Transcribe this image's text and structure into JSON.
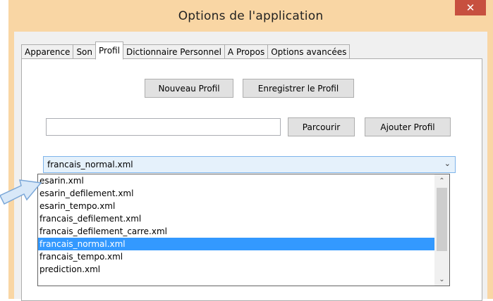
{
  "window": {
    "title": "Options de l'application",
    "close_glyph": "✕"
  },
  "tabs": [
    {
      "label": "Apparence"
    },
    {
      "label": "Son"
    },
    {
      "label": "Profil",
      "active": true
    },
    {
      "label": "Dictionnaire Personnel"
    },
    {
      "label": "A Propos"
    },
    {
      "label": "Options avancées"
    }
  ],
  "buttons": {
    "new_profile": "Nouveau Profil",
    "save_profile": "Enregistrer le Profil",
    "browse": "Parcourir",
    "add_profile": "Ajouter Profil"
  },
  "path_input": {
    "value": ""
  },
  "profile_select": {
    "selected": "francais_normal.xml",
    "options": [
      "esarin.xml",
      "esarin_defilement.xml",
      "esarin_tempo.xml",
      "francais_defilement.xml",
      "francais_defilement_carre.xml",
      "francais_normal.xml",
      "francais_tempo.xml",
      "prediction.xml"
    ]
  },
  "icons": {
    "dropdown": "chevron-down-icon",
    "scroll_up": "chevron-up-icon",
    "scroll_down": "chevron-down-icon",
    "pointer": "arrow-pointer-icon"
  },
  "colors": {
    "title_bar": "#f9d6a4",
    "close": "#c7503f",
    "selection": "#3399ff"
  }
}
